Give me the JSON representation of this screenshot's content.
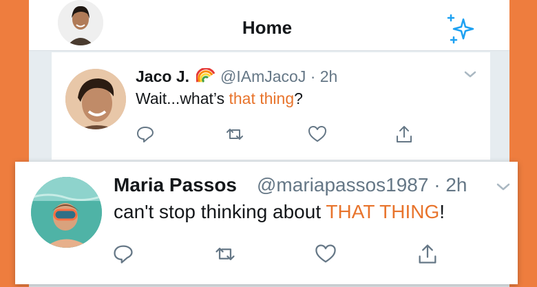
{
  "header": {
    "title": "Home",
    "avatar_icon": "profile-avatar",
    "sparkle_icon": "sparkle-icon"
  },
  "tweets": [
    {
      "name": "Jaco J.",
      "name_emoji": "rainbow",
      "handle": "@IAmJacoJ · 2h",
      "text_before": "Wait...what’s ",
      "text_highlight": "that thing",
      "text_after": "?",
      "actions": [
        "reply-icon",
        "retweet-icon",
        "like-icon",
        "share-icon"
      ]
    },
    {
      "name": "Maria Passos",
      "handle": "@mariapassos1987 · 2h",
      "text_before": "can't stop thinking about ",
      "text_highlight": "THAT THING",
      "text_after": "!",
      "actions": [
        "reply-icon",
        "retweet-icon",
        "like-icon",
        "share-icon"
      ]
    }
  ],
  "colors": {
    "background": "#ee7d3e",
    "accent": "#1da1f2",
    "highlight": "#e8742c",
    "muted": "#657786"
  }
}
